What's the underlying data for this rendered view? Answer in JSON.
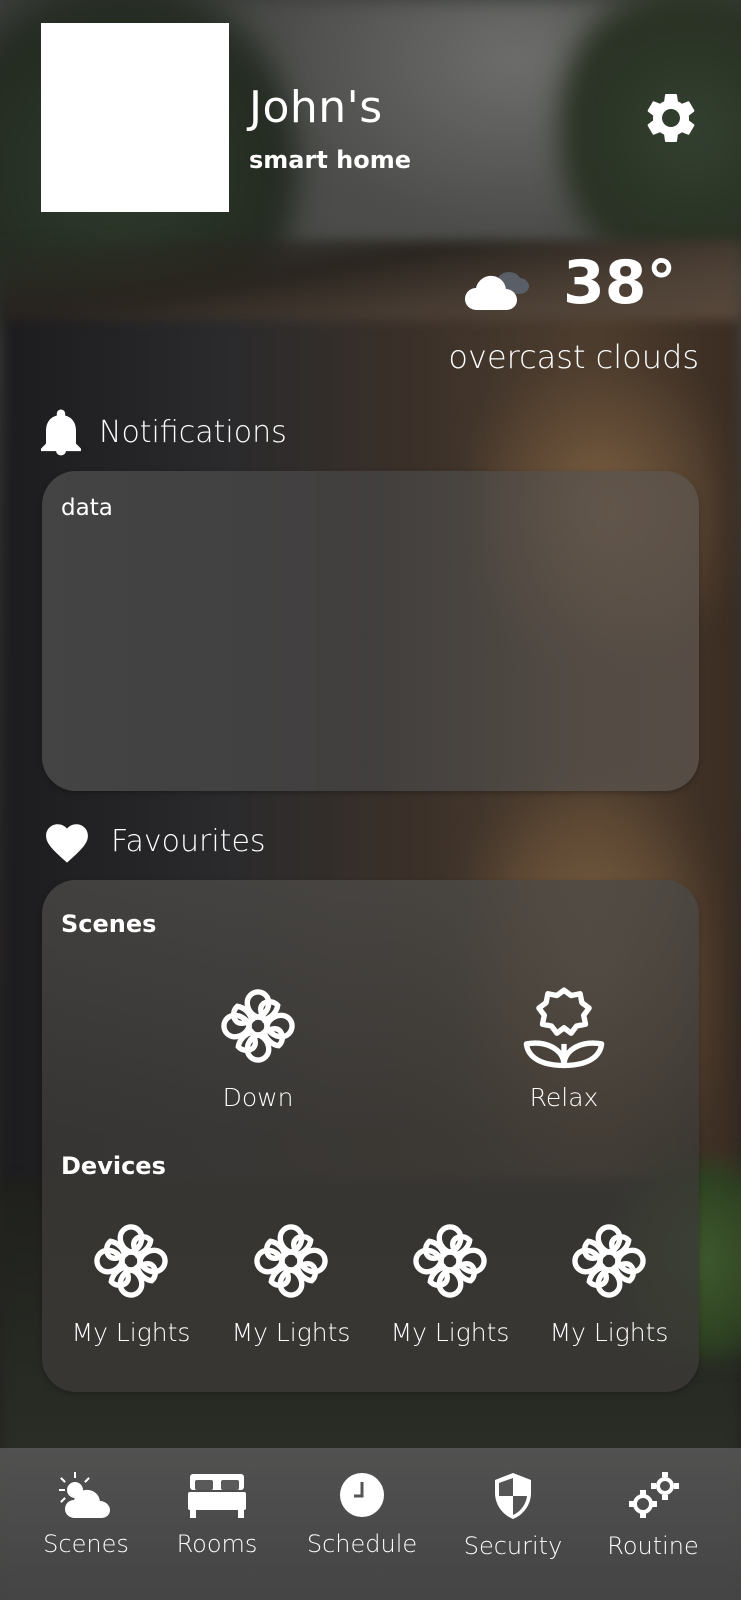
{
  "header": {
    "owner": "John's",
    "subtitle": "smart home"
  },
  "weather": {
    "temperature": "38°",
    "description": "overcast clouds",
    "icon": "cloud-icon"
  },
  "notifications": {
    "heading": "Notifications",
    "content": "data"
  },
  "favourites": {
    "heading": "Favourites",
    "scenes_label": "Scenes",
    "scenes": [
      {
        "label": "Down",
        "icon": "flower-icon"
      },
      {
        "label": "Relax",
        "icon": "lotus-icon"
      }
    ],
    "devices_label": "Devices",
    "devices": [
      {
        "label": "My Lights",
        "icon": "flower-icon"
      },
      {
        "label": "My Lights",
        "icon": "flower-icon"
      },
      {
        "label": "My Lights",
        "icon": "flower-icon"
      },
      {
        "label": "My Lights",
        "icon": "flower-icon"
      }
    ]
  },
  "nav": [
    {
      "label": "Scenes",
      "icon": "sun-cloud-icon"
    },
    {
      "label": "Rooms",
      "icon": "bed-icon"
    },
    {
      "label": "Schedule",
      "icon": "clock-icon"
    },
    {
      "label": "Security",
      "icon": "shield-icon"
    },
    {
      "label": "Routine",
      "icon": "gears-icon"
    }
  ]
}
